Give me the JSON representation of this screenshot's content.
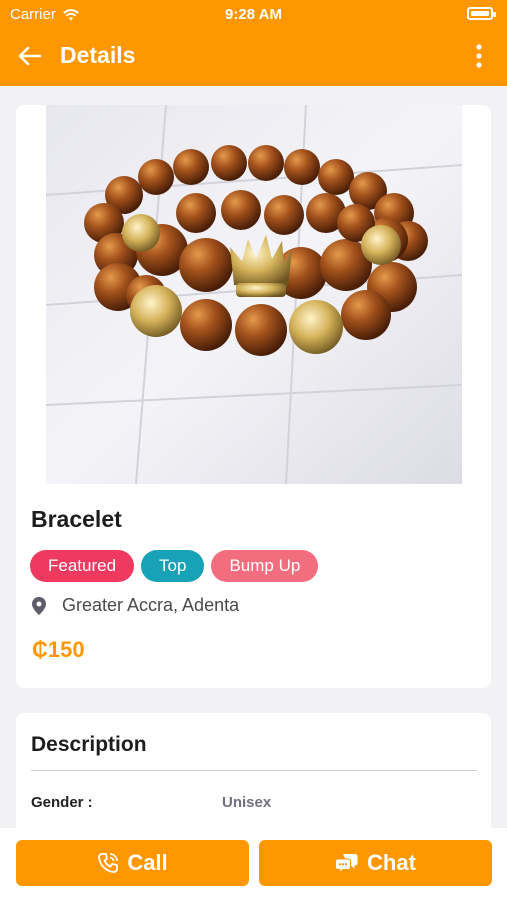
{
  "status_bar": {
    "carrier": "Carrier",
    "time": "9:28 AM"
  },
  "header": {
    "title": "Details"
  },
  "product": {
    "name": "Bracelet",
    "badges": [
      "Featured",
      "Top",
      "Bump Up"
    ],
    "location": "Greater Accra, Adenta",
    "price": "₵150"
  },
  "description": {
    "title": "Description",
    "gender_label": "Gender :",
    "gender_value": "Unisex"
  },
  "actions": {
    "call_label": "Call",
    "chat_label": "Chat"
  },
  "colors": {
    "accent": "#ff9800",
    "featured": "#f0395e",
    "top": "#17a2b8",
    "bump": "#f26e7e"
  },
  "icons": [
    "wifi-icon",
    "battery-icon",
    "back-arrow-icon",
    "more-vertical-icon",
    "location-pin-icon",
    "phone-icon",
    "chat-icon"
  ]
}
